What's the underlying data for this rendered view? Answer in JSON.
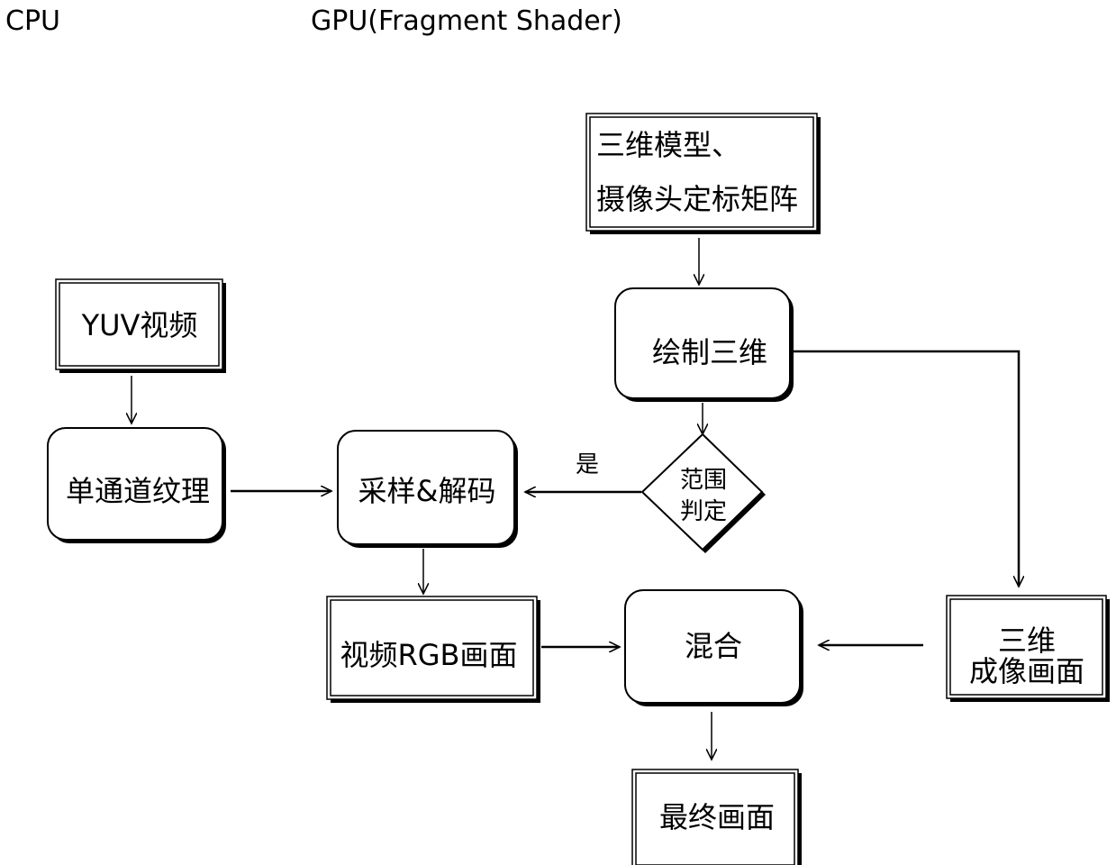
{
  "headers": {
    "cpu": "CPU",
    "gpu": "GPU(Fragment Shader)"
  },
  "nodes": {
    "model_matrix": {
      "lines": [
        "三维模型、",
        "摄像头定标矩阵"
      ],
      "shape": "rectangle-double"
    },
    "yuv_video": {
      "lines": [
        "YUV视频"
      ],
      "shape": "rectangle-double"
    },
    "draw_3d": {
      "lines": [
        "绘制三维"
      ],
      "shape": "rounded-rectangle"
    },
    "single_channel_texture": {
      "lines": [
        "单通道纹理"
      ],
      "shape": "rounded-rectangle"
    },
    "sample_decode": {
      "lines": [
        "采样&解码"
      ],
      "shape": "rounded-rectangle"
    },
    "range_check": {
      "lines": [
        "范围",
        "判定"
      ],
      "shape": "diamond"
    },
    "video_rgb": {
      "lines": [
        "视频RGB画面"
      ],
      "shape": "rectangle-double"
    },
    "blend": {
      "lines": [
        "混合"
      ],
      "shape": "rounded-rectangle"
    },
    "render_3d_image": {
      "lines": [
        "三维",
        "成像画面"
      ],
      "shape": "rectangle-double"
    },
    "final_image": {
      "lines": [
        "最终画面"
      ],
      "shape": "rectangle-double"
    }
  },
  "edges": [
    {
      "from": "model_matrix",
      "to": "draw_3d",
      "label": ""
    },
    {
      "from": "yuv_video",
      "to": "single_channel_texture",
      "label": ""
    },
    {
      "from": "draw_3d",
      "to": "range_check",
      "label": ""
    },
    {
      "from": "draw_3d",
      "to": "render_3d_image",
      "label": ""
    },
    {
      "from": "single_channel_texture",
      "to": "sample_decode",
      "label": ""
    },
    {
      "from": "range_check",
      "to": "sample_decode",
      "label": "是"
    },
    {
      "from": "sample_decode",
      "to": "video_rgb",
      "label": ""
    },
    {
      "from": "video_rgb",
      "to": "blend",
      "label": ""
    },
    {
      "from": "render_3d_image",
      "to": "blend",
      "label": ""
    },
    {
      "from": "blend",
      "to": "final_image",
      "label": ""
    }
  ]
}
